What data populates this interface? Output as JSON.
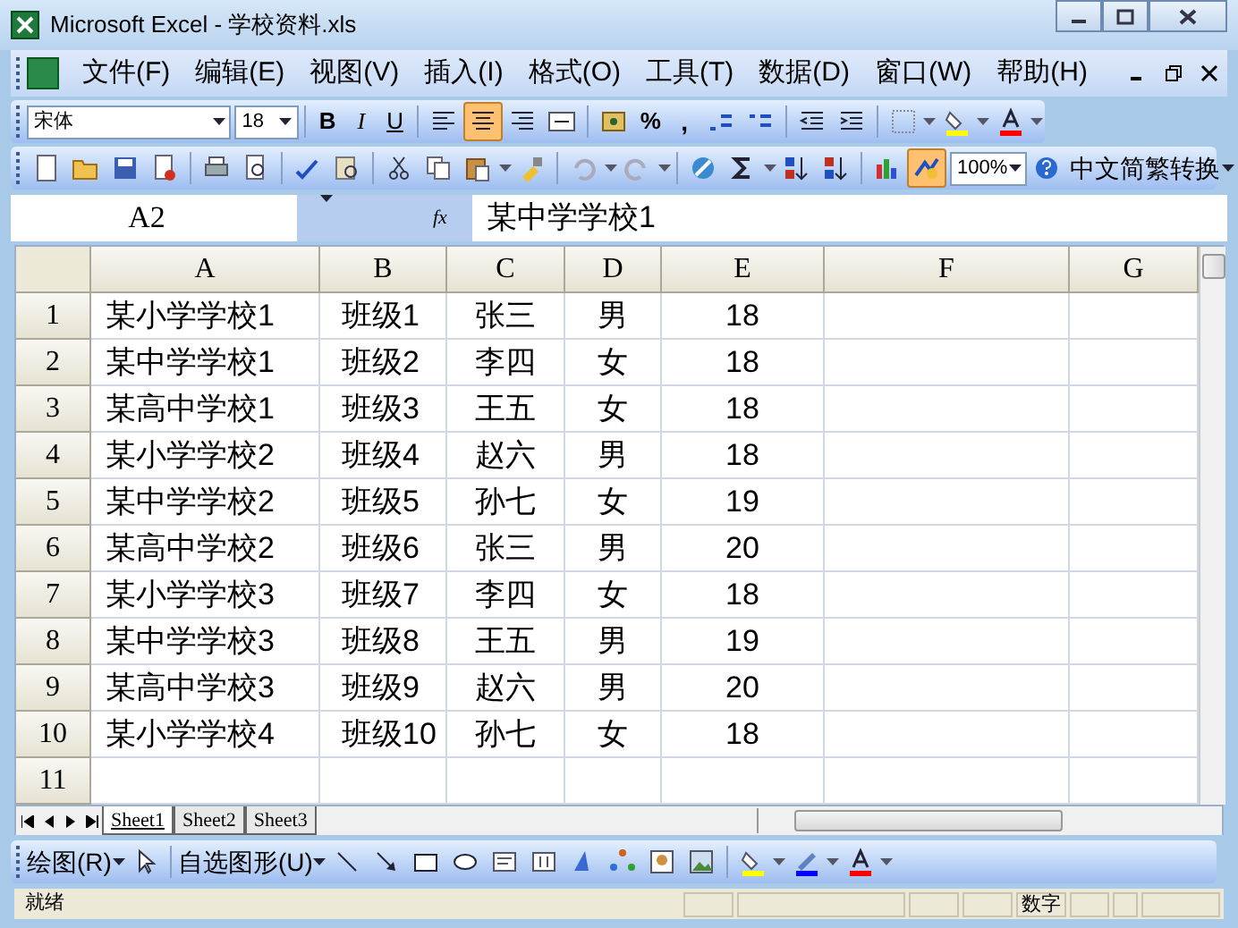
{
  "window": {
    "title": "Microsoft Excel - 学校资料.xls"
  },
  "menu": [
    "文件(F)",
    "编辑(E)",
    "视图(V)",
    "插入(I)",
    "格式(O)",
    "工具(T)",
    "数据(D)",
    "窗口(W)",
    "帮助(H)"
  ],
  "format_toolbar": {
    "font": "宋体",
    "size": "18",
    "styles": [
      {
        "label": "B"
      },
      {
        "label": "I"
      },
      {
        "label": "U"
      }
    ],
    "align": [
      {
        "selected": false
      },
      {
        "selected": true
      },
      {
        "selected": false
      },
      {
        "selected": false
      }
    ],
    "percent": "%",
    "comma": ","
  },
  "standard_toolbar": {
    "drawing_on": true,
    "zoom": "100%",
    "convert": "中文简繁转换"
  },
  "formula_bar": {
    "name_box": "A2",
    "fx": "fx",
    "content": "某中学学校1"
  },
  "sheet": {
    "columns": [
      "A",
      "B",
      "C",
      "D",
      "E",
      "F",
      "G"
    ],
    "rows": [
      {
        "header": "1",
        "cells": [
          "某小学学校1",
          "班级1",
          "张三",
          "男",
          "18"
        ]
      },
      {
        "header": "2",
        "cells": [
          "某中学学校1",
          "班级2",
          "李四",
          "女",
          "18"
        ]
      },
      {
        "header": "3",
        "cells": [
          "某高中学校1",
          "班级3",
          "王五",
          "女",
          "18"
        ]
      },
      {
        "header": "4",
        "cells": [
          "某小学学校2",
          "班级4",
          "赵六",
          "男",
          "18"
        ]
      },
      {
        "header": "5",
        "cells": [
          "某中学学校2",
          "班级5",
          "孙七",
          "女",
          "19"
        ]
      },
      {
        "header": "6",
        "cells": [
          "某高中学校2",
          "班级6",
          "张三",
          "男",
          "20"
        ]
      },
      {
        "header": "7",
        "cells": [
          "某小学学校3",
          "班级7",
          "李四",
          "女",
          "18"
        ]
      },
      {
        "header": "8",
        "cells": [
          "某中学学校3",
          "班级8",
          "王五",
          "男",
          "19"
        ]
      },
      {
        "header": "9",
        "cells": [
          "某高中学校3",
          "班级9",
          "赵六",
          "男",
          "20"
        ]
      },
      {
        "header": "10",
        "cells": [
          "某小学学校4",
          "班级10",
          "孙七",
          "女",
          "18"
        ]
      },
      {
        "header": "11",
        "cells": []
      }
    ]
  },
  "sheet_tabs": [
    {
      "label": "Sheet1",
      "selected": true
    },
    {
      "label": "Sheet2",
      "selected": false
    },
    {
      "label": "Sheet3",
      "selected": false
    }
  ],
  "drawing_toolbar": {
    "draw": "绘图(R)",
    "autoshapes": "自选图形(U)"
  },
  "status_bar": {
    "status": "就绪",
    "num": "数字"
  }
}
